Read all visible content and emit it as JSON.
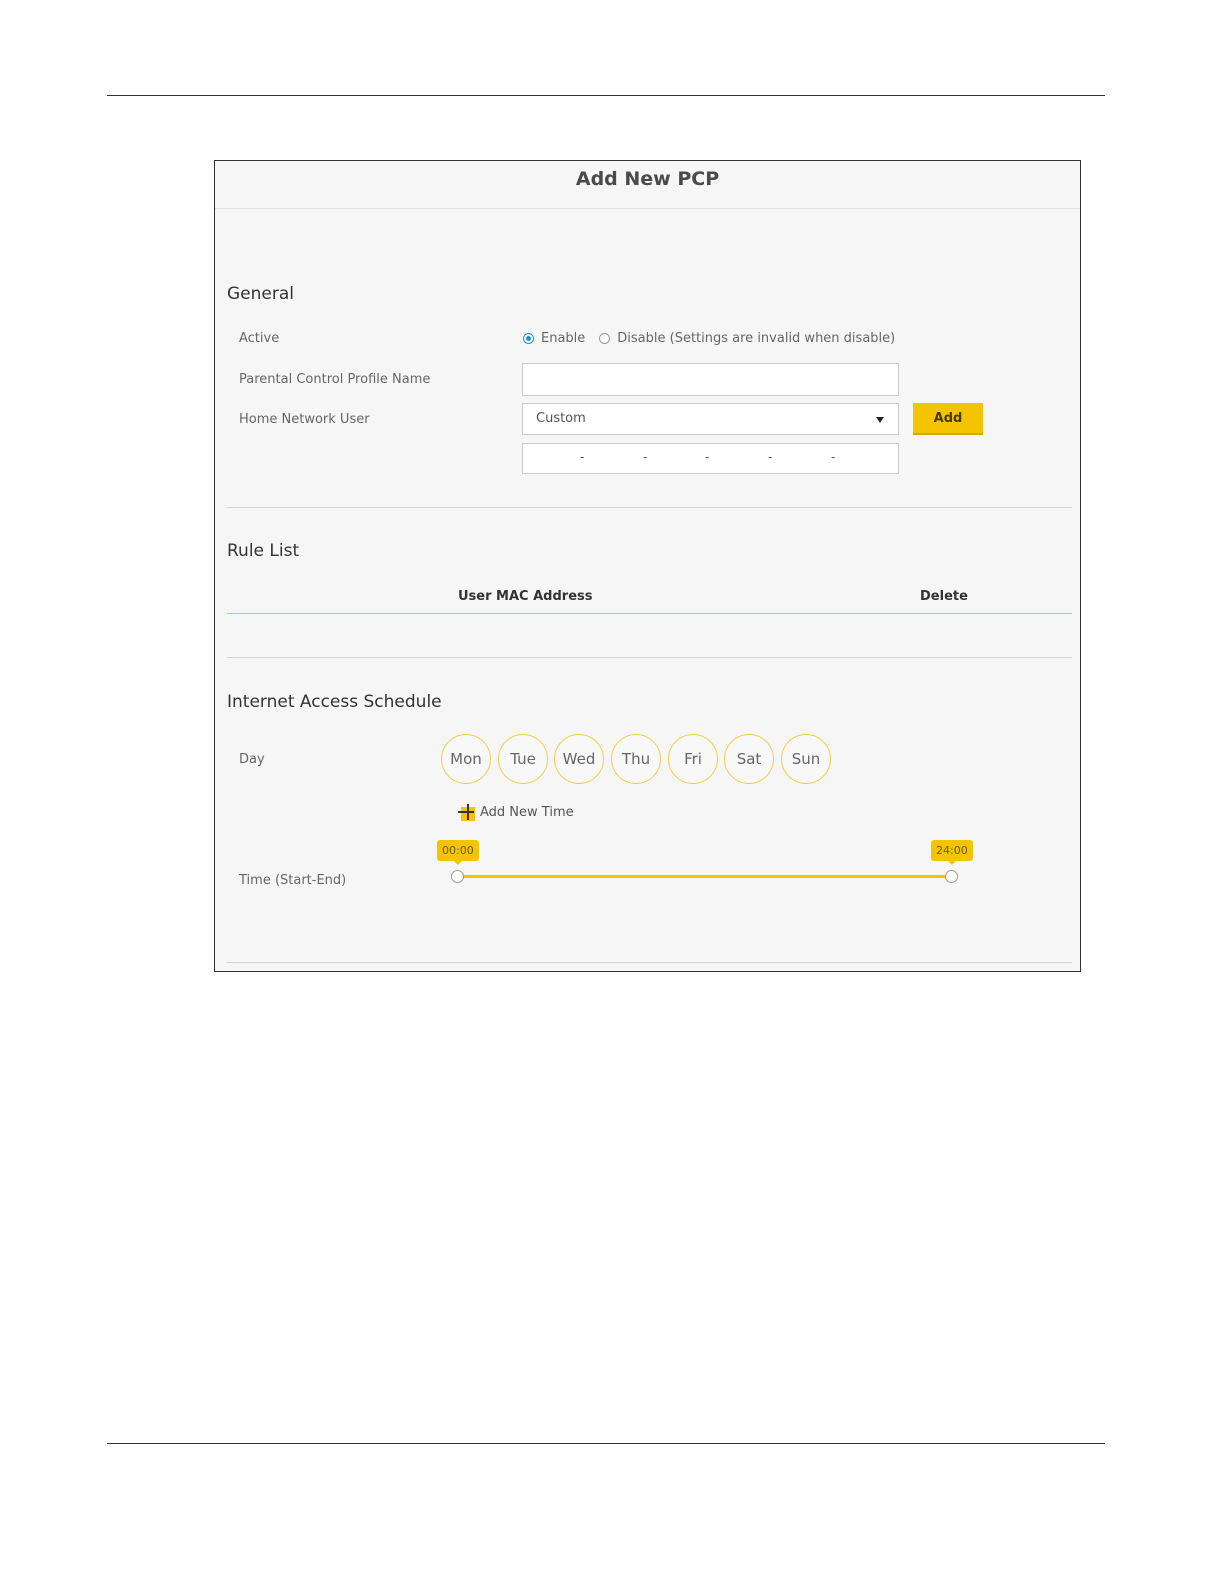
{
  "dialog": {
    "title": "Add New PCP"
  },
  "general": {
    "heading": "General",
    "active_label": "Active",
    "enable_label": "Enable",
    "disable_label": "Disable (Settings are invalid when disable)",
    "active_value": "Enable",
    "profile_name_label": "Parental Control Profile Name",
    "profile_name_value": "",
    "home_user_label": "Home Network User",
    "home_user_selected": "Custom",
    "add_label": "Add",
    "mac_separators": [
      "-",
      "-",
      "-",
      "-",
      "-"
    ]
  },
  "rule_list": {
    "heading": "Rule List",
    "columns": [
      "User MAC Address",
      "Delete"
    ],
    "rows": []
  },
  "schedule": {
    "heading": "Internet Access Schedule",
    "day_label": "Day",
    "days": [
      "Mon",
      "Tue",
      "Wed",
      "Thu",
      "Fri",
      "Sat",
      "Sun"
    ],
    "add_time_label": "Add New Time",
    "time_label": "Time (Start-End)",
    "start_time": "00:00",
    "end_time": "24:00"
  },
  "colors": {
    "accent": "#f5c400",
    "radio_selected": "#1a8fd8"
  },
  "icons": {
    "add_time": "plus-icon",
    "dropdown": "caret-down-icon"
  }
}
